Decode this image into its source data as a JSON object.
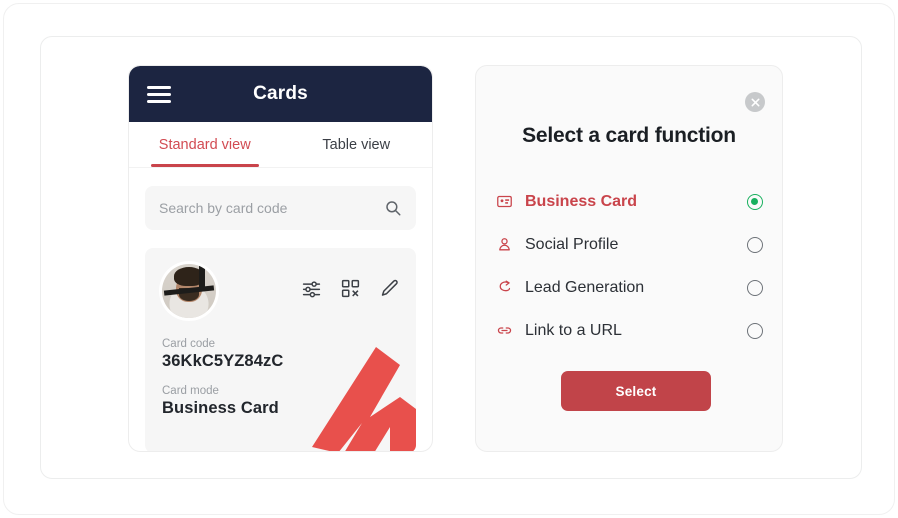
{
  "phone": {
    "menu_icon": "hamburger-menu-icon",
    "title": "Cards",
    "tabs": [
      {
        "label": "Standard view",
        "active": true
      },
      {
        "label": "Table view",
        "active": false
      }
    ],
    "search": {
      "placeholder": "Search by card code",
      "value": "",
      "icon": "search-icon"
    },
    "card": {
      "avatar": "user-avatar-photo",
      "actions": [
        {
          "icon": "sliders-settings-icon"
        },
        {
          "icon": "qr-code-icon"
        },
        {
          "icon": "pencil-edit-icon"
        }
      ],
      "fields": [
        {
          "label": "Card code",
          "value": "36KkC5YZ84zC"
        },
        {
          "label": "Card mode",
          "value": "Business Card"
        }
      ],
      "logo": "m-brand-logo"
    }
  },
  "dialog": {
    "close_icon": "close-x-icon",
    "title": "Select a card function",
    "options": [
      {
        "label": "Business Card",
        "icon": "id-card-icon",
        "selected": true
      },
      {
        "label": "Social Profile",
        "icon": "person-icon",
        "selected": false
      },
      {
        "label": "Lead Generation",
        "icon": "lead-arrow-icon",
        "selected": false
      },
      {
        "label": "Link to a URL",
        "icon": "link-chain-icon",
        "selected": false
      }
    ],
    "submit_label": "Select"
  },
  "colors": {
    "header_navy": "#1c2541",
    "accent_red": "#c9444b",
    "button_red": "#c14449",
    "radio_green": "#18b05e",
    "logo_red": "#e8504c",
    "tile_grey": "#f6f6f6"
  }
}
